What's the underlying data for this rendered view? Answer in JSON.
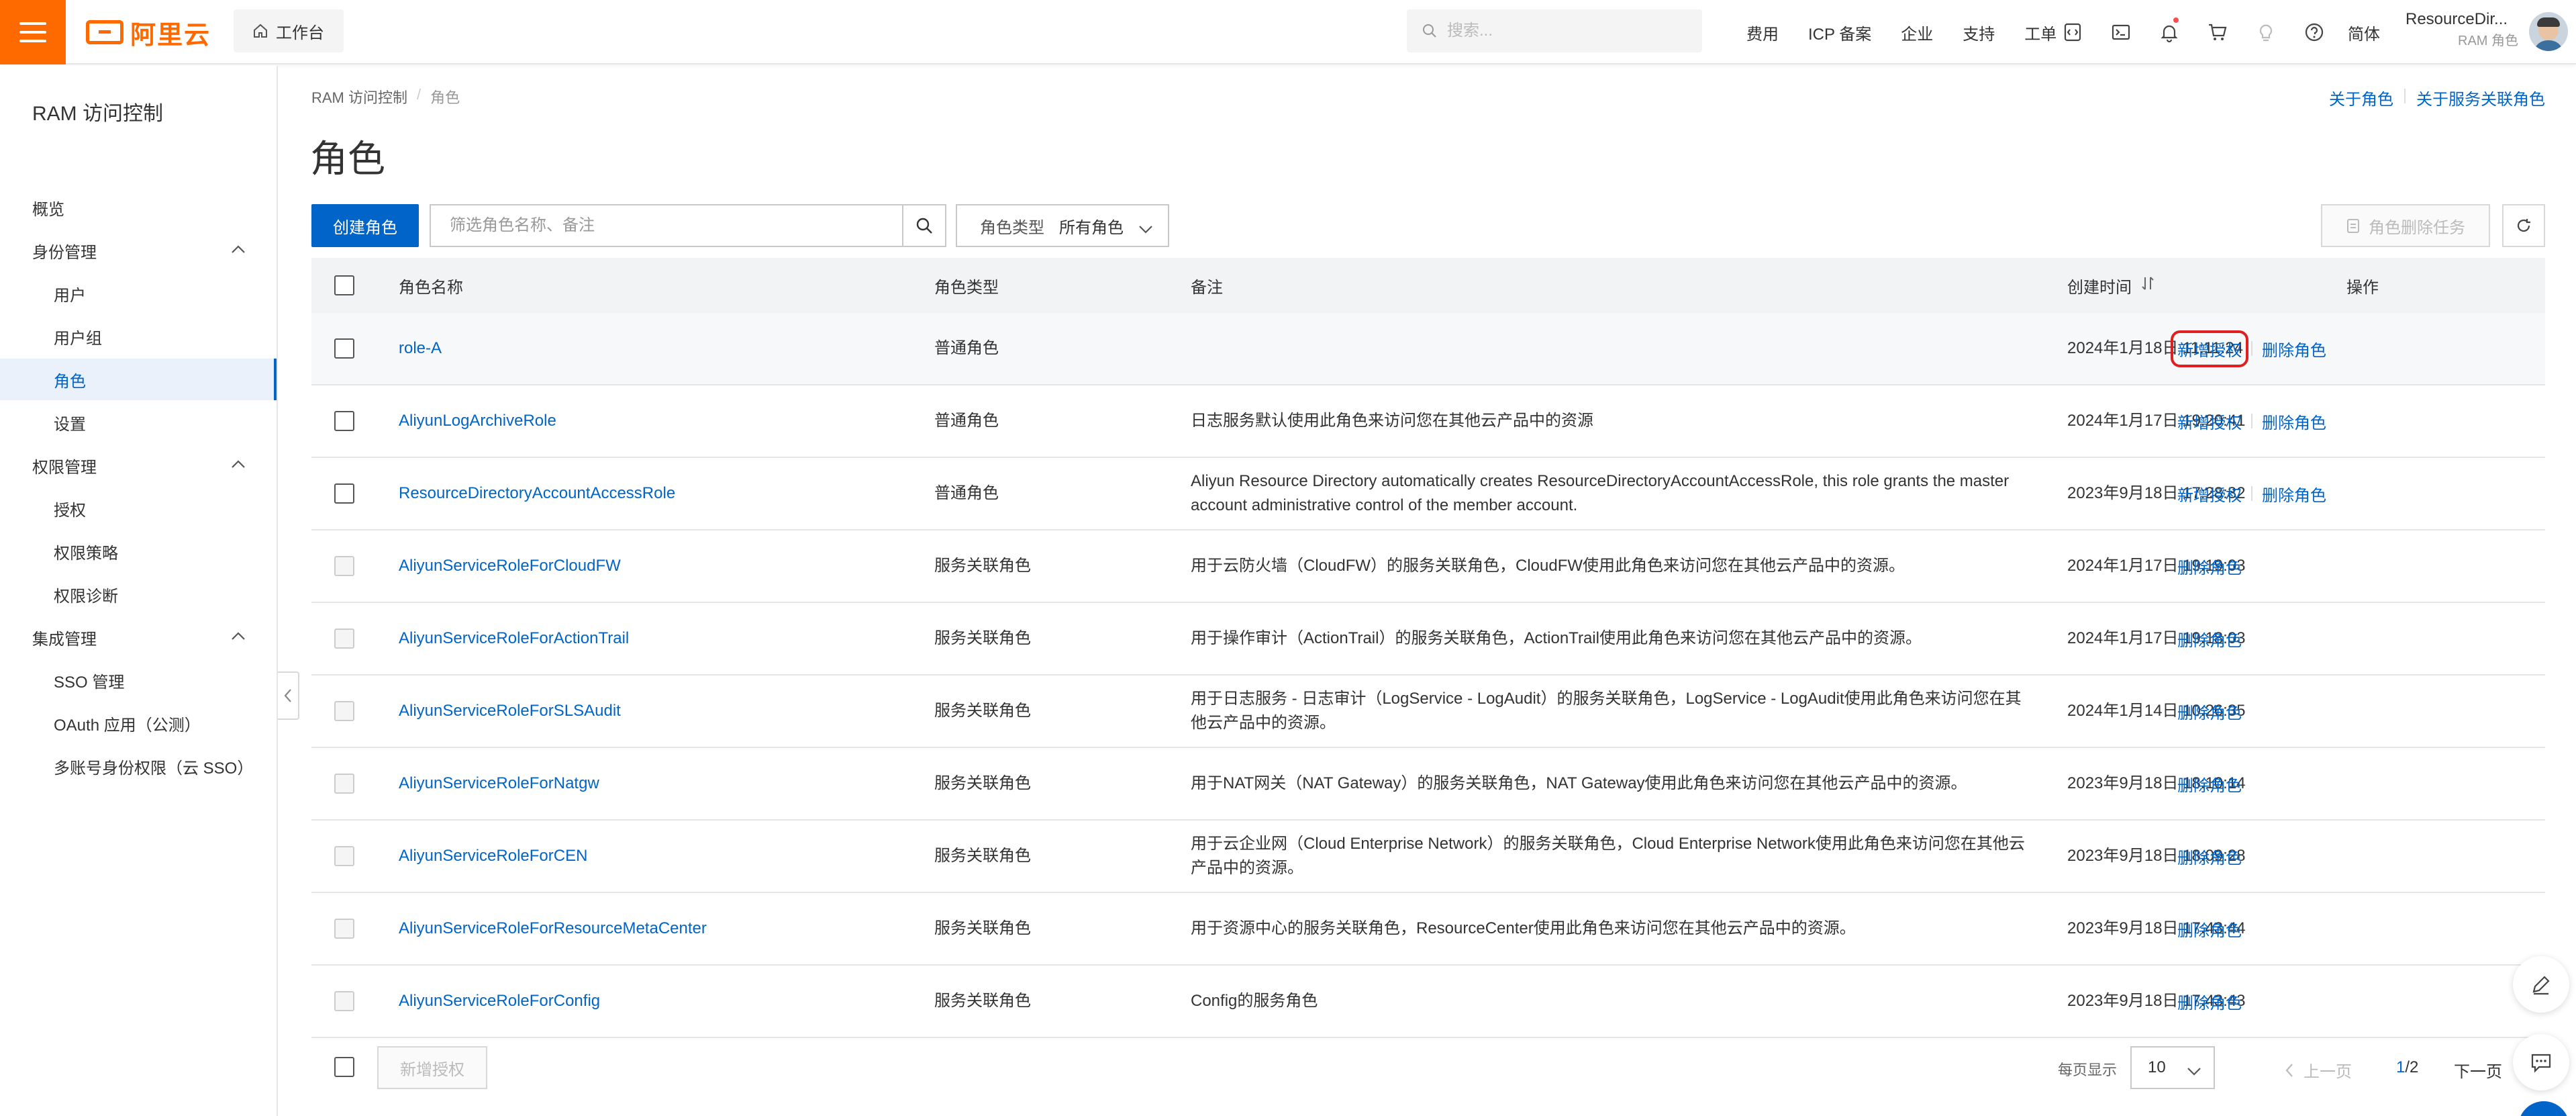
{
  "topbar": {
    "logo_text": "阿里云",
    "workbench_label": "工作台",
    "search_placeholder": "搜索...",
    "nav_links": [
      "费用",
      "ICP 备案",
      "企业",
      "支持",
      "工单"
    ],
    "lang": "简体",
    "account_name": "ResourceDir...",
    "account_role": "RAM 角色"
  },
  "sidebar": {
    "title": "RAM 访问控制",
    "items": [
      {
        "label": "概览",
        "level": 1
      },
      {
        "label": "身份管理",
        "level": 1,
        "group": true
      },
      {
        "label": "用户",
        "level": 2
      },
      {
        "label": "用户组",
        "level": 2
      },
      {
        "label": "角色",
        "level": 2,
        "active": true
      },
      {
        "label": "设置",
        "level": 2
      },
      {
        "label": "权限管理",
        "level": 1,
        "group": true
      },
      {
        "label": "授权",
        "level": 2
      },
      {
        "label": "权限策略",
        "level": 2
      },
      {
        "label": "权限诊断",
        "level": 2
      },
      {
        "label": "集成管理",
        "level": 1,
        "group": true
      },
      {
        "label": "SSO 管理",
        "level": 2
      },
      {
        "label": "OAuth 应用（公测）",
        "level": 2
      },
      {
        "label": "多账号身份权限（云 SSO）",
        "level": 2
      }
    ]
  },
  "main": {
    "breadcrumb": [
      "RAM 访问控制",
      "角色"
    ],
    "help_links": [
      "关于角色",
      "关于服务关联角色"
    ],
    "title": "角色",
    "create_button": "创建角色",
    "search_placeholder": "筛选角色名称、备注",
    "role_type_label": "角色类型",
    "role_type_value": "所有角色",
    "delete_tasks_button": "角色删除任务",
    "columns": [
      "角色名称",
      "角色类型",
      "备注",
      "创建时间",
      "操作"
    ],
    "rows": [
      {
        "name": "role-A",
        "type": "普通角色",
        "note": "",
        "created": "2024年1月18日 11:11:24",
        "ops": [
          "新增授权",
          "删除角色"
        ],
        "selectable": true
      },
      {
        "name": "AliyunLogArchiveRole",
        "type": "普通角色",
        "note": "日志服务默认使用此角色来访问您在其他云产品中的资源",
        "created": "2024年1月17日 19:20:41",
        "ops": [
          "新增授权",
          "删除角色"
        ],
        "selectable": true
      },
      {
        "name": "ResourceDirectoryAccountAccessRole",
        "type": "普通角色",
        "note": "Aliyun Resource Directory automatically creates ResourceDirectoryAccountAccessRole, this role grants the master account administrative control of the member account.",
        "created": "2023年9月18日 17:28:32",
        "ops": [
          "新增授权",
          "删除角色"
        ],
        "selectable": true
      },
      {
        "name": "AliyunServiceRoleForCloudFW",
        "type": "服务关联角色",
        "note": "用于云防火墙（CloudFW）的服务关联角色，CloudFW使用此角色来访问您在其他云产品中的资源。",
        "created": "2024年1月17日 19:19:03",
        "ops": [
          "删除角色"
        ],
        "selectable": false
      },
      {
        "name": "AliyunServiceRoleForActionTrail",
        "type": "服务关联角色",
        "note": "用于操作审计（ActionTrail）的服务关联角色，ActionTrail使用此角色来访问您在其他云产品中的资源。",
        "created": "2024年1月17日 19:18:03",
        "ops": [
          "删除角色"
        ],
        "selectable": false
      },
      {
        "name": "AliyunServiceRoleForSLSAudit",
        "type": "服务关联角色",
        "note": "用于日志服务 - 日志审计（LogService - LogAudit）的服务关联角色，LogService - LogAudit使用此角色来访问您在其他云产品中的资源。",
        "created": "2024年1月14日 10:26:35",
        "ops": [
          "删除角色"
        ],
        "selectable": false
      },
      {
        "name": "AliyunServiceRoleForNatgw",
        "type": "服务关联角色",
        "note": "用于NAT网关（NAT Gateway）的服务关联角色，NAT Gateway使用此角色来访问您在其他云产品中的资源。",
        "created": "2023年9月18日 18:10:14",
        "ops": [
          "删除角色"
        ],
        "selectable": false
      },
      {
        "name": "AliyunServiceRoleForCEN",
        "type": "服务关联角色",
        "note": "用于云企业网（Cloud Enterprise Network）的服务关联角色，Cloud Enterprise Network使用此角色来访问您在其他云产品中的资源。",
        "created": "2023年9月18日 18:09:28",
        "ops": [
          "删除角色"
        ],
        "selectable": false
      },
      {
        "name": "AliyunServiceRoleForResourceMetaCenter",
        "type": "服务关联角色",
        "note": "用于资源中心的服务关联角色，ResourceCenter使用此角色来访问您在其他云产品中的资源。",
        "created": "2023年9月18日 17:43:44",
        "ops": [
          "删除角色"
        ],
        "selectable": false
      },
      {
        "name": "AliyunServiceRoleForConfig",
        "type": "服务关联角色",
        "note": "Config的服务角色",
        "created": "2023年9月18日 17:43:43",
        "ops": [
          "删除角色"
        ],
        "selectable": false
      }
    ],
    "footer": {
      "batch_button": "新增授权",
      "per_page_label": "每页显示",
      "per_page_value": "10",
      "prev_label": "上一页",
      "page_current": "1",
      "page_total": "/2",
      "next_label": "下一页"
    }
  },
  "colors": {
    "brand_orange": "#ff6a00",
    "primary_blue": "#0064c8",
    "highlight_red": "#e02020"
  }
}
